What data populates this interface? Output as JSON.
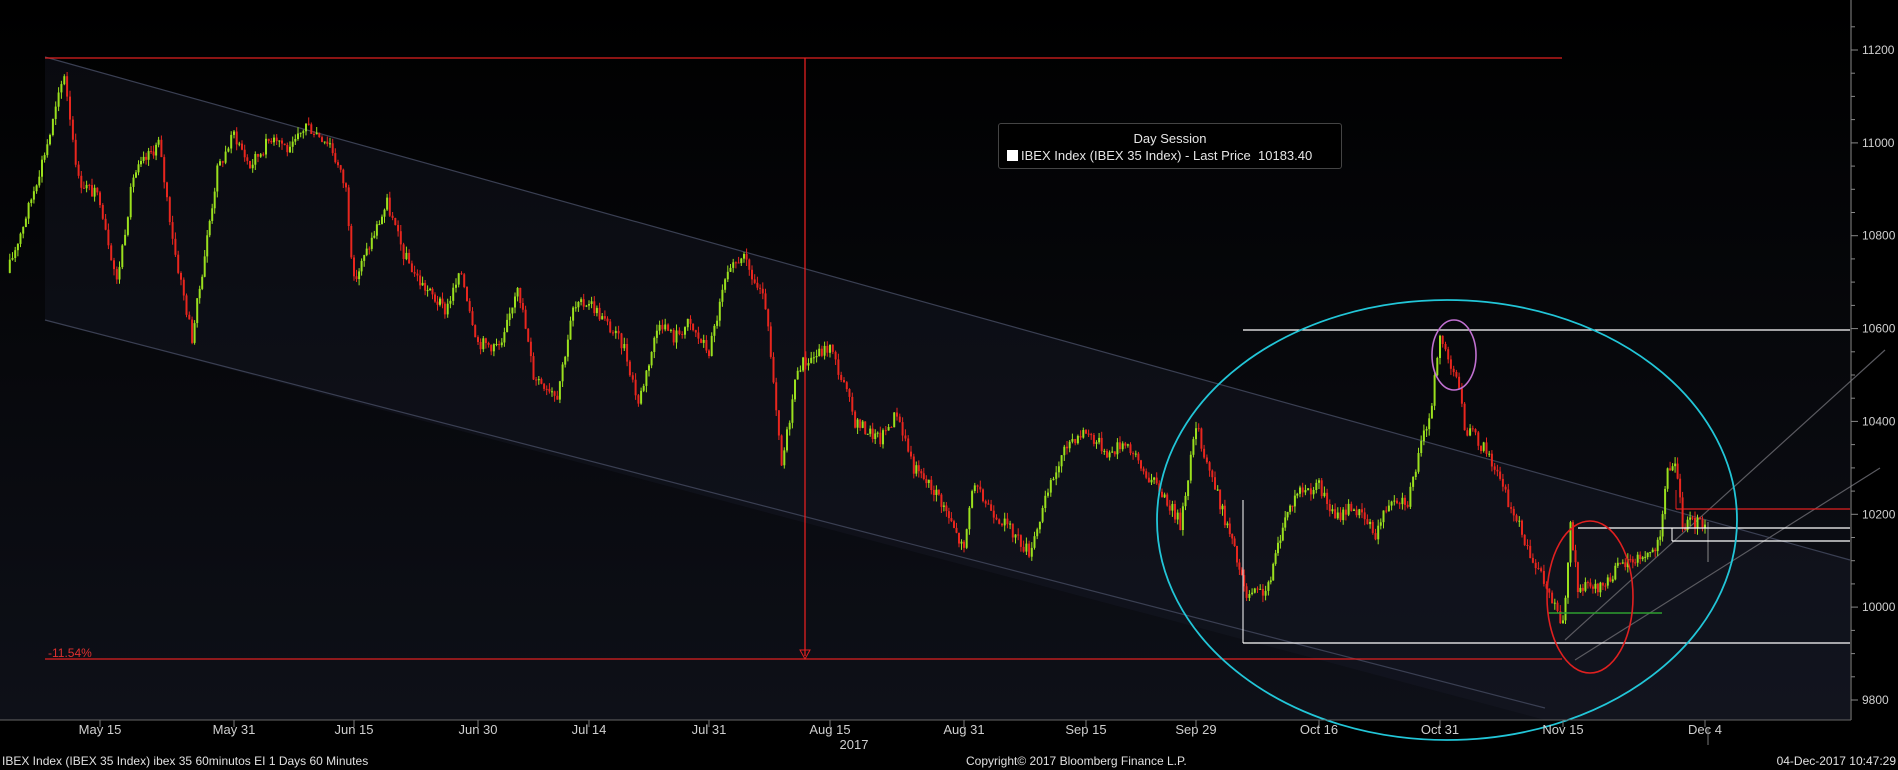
{
  "chart_data": {
    "type": "candlestick",
    "title": "",
    "y_axis": {
      "side": "right",
      "ylim": [
        9720,
        11260
      ],
      "ticks": [
        9800,
        10000,
        10200,
        10400,
        10600,
        10800,
        11000,
        11200
      ]
    },
    "x_axis": {
      "tick_labels": [
        "May 15",
        "May 31",
        "Jun 15",
        "Jun 30",
        "Jul 14",
        "Jul 31",
        "Aug 15",
        "Aug 31",
        "Sep 15",
        "Sep 29",
        "Oct 16",
        "Oct 31",
        "Nov 15",
        "Dec 4"
      ],
      "year_label": "2017"
    },
    "legend": {
      "title": "Day Session",
      "entries": [
        {
          "label": "IBEX Index (IBEX 35 Index) - Last Price",
          "value": "10183.40",
          "color": "#ffffff"
        }
      ]
    },
    "annotations": {
      "decline_label": "-11.54%"
    },
    "series": [
      {
        "name": "IBEX Index (IBEX 35 Index) - Last Price",
        "x": [
          "May 2",
          "May 5",
          "May 8",
          "May 10",
          "May 12",
          "May 15",
          "May 17",
          "May 19",
          "May 22",
          "May 24",
          "May 26",
          "May 29",
          "May 31",
          "Jun 2",
          "Jun 5",
          "Jun 7",
          "Jun 9",
          "Jun 12",
          "Jun 14",
          "Jun 15",
          "Jun 19",
          "Jun 21",
          "Jun 23",
          "Jun 26",
          "Jun 28",
          "Jun 30",
          "Jul 3",
          "Jul 5",
          "Jul 7",
          "Jul 10",
          "Jul 12",
          "Jul 14",
          "Jul 17",
          "Jul 19",
          "Jul 21",
          "Jul 24",
          "Jul 26",
          "Jul 28",
          "Jul 31",
          "Aug 2",
          "Aug 4",
          "Aug 7",
          "Aug 9",
          "Aug 11",
          "Aug 15",
          "Aug 17",
          "Aug 18",
          "Aug 21",
          "Aug 23",
          "Aug 25",
          "Aug 28",
          "Aug 31",
          "Sep 1",
          "Sep 4",
          "Sep 6",
          "Sep 8",
          "Sep 11",
          "Sep 13",
          "Sep 15",
          "Sep 18",
          "Sep 20",
          "Sep 22",
          "Sep 25",
          "Sep 27",
          "Sep 29",
          "Oct 2",
          "Oct 4",
          "Oct 6",
          "Oct 9",
          "Oct 11",
          "Oct 13",
          "Oct 16",
          "Oct 18",
          "Oct 20",
          "Oct 23",
          "Oct 25",
          "Oct 27",
          "Oct 30",
          "Oct 31",
          "Nov 2",
          "Nov 3",
          "Nov 6",
          "Nov 8",
          "Nov 10",
          "Nov 13",
          "Nov 14",
          "Nov 15",
          "Nov 16",
          "Nov 17",
          "Nov 20",
          "Nov 22",
          "Nov 24",
          "Nov 27",
          "Nov 28",
          "Nov 29",
          "Nov 30",
          "Dec 1",
          "Dec 4"
        ],
        "y": [
          10720,
          10860,
          11020,
          11150,
          10920,
          10880,
          10700,
          10930,
          11000,
          10760,
          10580,
          10940,
          11020,
          10950,
          11020,
          10980,
          11040,
          11000,
          10900,
          10700,
          10870,
          10760,
          10700,
          10640,
          10720,
          10570,
          10560,
          10700,
          10500,
          10460,
          10640,
          10660,
          10600,
          10560,
          10440,
          10620,
          10580,
          10610,
          10550,
          10700,
          10760,
          10650,
          10300,
          10520,
          10560,
          10460,
          10400,
          10360,
          10420,
          10300,
          10240,
          10120,
          10260,
          10200,
          10160,
          10120,
          10280,
          10360,
          10380,
          10330,
          10360,
          10300,
          10240,
          10180,
          10390,
          10240,
          10140,
          10020,
          10040,
          10180,
          10250,
          10260,
          10190,
          10220,
          10160,
          10240,
          10230,
          10440,
          10580,
          10500,
          10390,
          10330,
          10240,
          10160,
          10040,
          10000,
          9960,
          10170,
          10040,
          10040,
          10080,
          10100,
          10120,
          10140,
          10300,
          10310,
          10180,
          10183.4
        ]
      }
    ]
  },
  "footer": {
    "left": "IBEX Index (IBEX 35 Index) ibex 35 60minutos EI 1 Days 60 Minutes",
    "center": "Copyright© 2017 Bloomberg Finance L.P.",
    "right": "04-Dec-2017 10:47:29"
  }
}
